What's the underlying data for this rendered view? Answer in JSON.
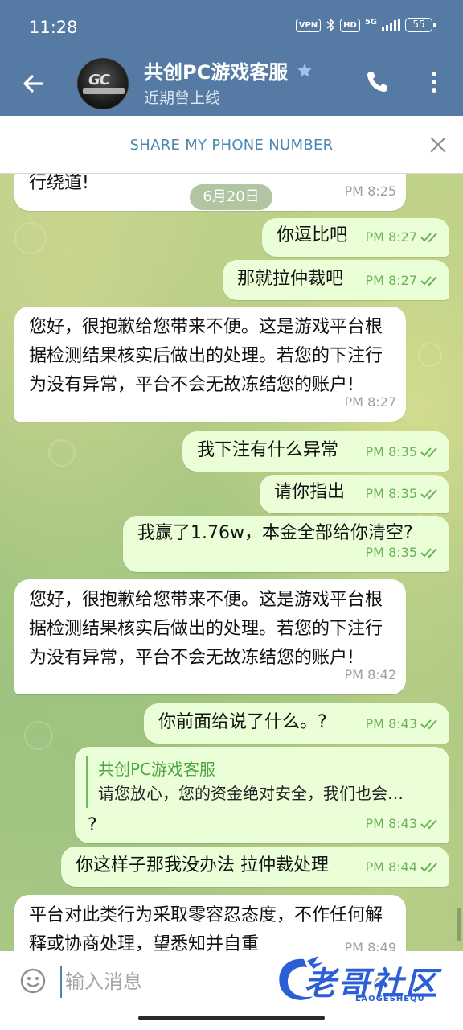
{
  "status_bar": {
    "time": "11:28",
    "vpn": "VPN",
    "hd": "HD",
    "network": "5G",
    "battery": "55"
  },
  "header": {
    "title": "共创PC游戏客服",
    "status": "近期曾上线",
    "avatar_mark": "GC"
  },
  "share_bar": {
    "label": "SHARE MY PHONE NUMBER"
  },
  "date_pill": "6月20日",
  "messages": [
    {
      "dir": "in",
      "text": "行绕道!",
      "time": "PM 8:25"
    },
    {
      "dir": "out",
      "text": "你逗比吧",
      "time": "PM 8:27"
    },
    {
      "dir": "out",
      "text": "那就拉仲裁吧",
      "time": "PM 8:27"
    },
    {
      "dir": "in",
      "text": "您好，很抱歉给您带来不便。这是游戏平台根据检测结果核实后做出的处理。若您的下注行为没有异常，平台不会无故冻结您的账户!",
      "time": "PM 8:27"
    },
    {
      "dir": "out",
      "text": "我下注有什么异常",
      "time": "PM 8:35"
    },
    {
      "dir": "out",
      "text": "请你指出",
      "time": "PM 8:35"
    },
    {
      "dir": "out",
      "text": "我赢了1.76w，本金全部给你清空?",
      "time": "PM 8:35"
    },
    {
      "dir": "in",
      "text": "您好，很抱歉给您带来不便。这是游戏平台根据检测结果核实后做出的处理。若您的下注行为没有异常，平台不会无故冻结您的账户!",
      "time": "PM 8:42"
    },
    {
      "dir": "out",
      "text": "你前面给说了什么。?",
      "time": "PM 8:43"
    },
    {
      "dir": "out",
      "reply_title": "共创PC游戏客服",
      "reply_text": "请您放心，您的资金绝对安全，我们也会…",
      "text": "?",
      "time": "PM 8:43"
    },
    {
      "dir": "out",
      "text": "你这样子那我没办法 拉仲裁处理",
      "time": "PM 8:44"
    },
    {
      "dir": "in",
      "text": "平台对此类行为采取零容忍态度，不作任何解释或协商处理，望悉知并自重",
      "time": "PM 8:49"
    }
  ],
  "input": {
    "placeholder": "输入消息"
  },
  "watermark": {
    "text": "老哥社区",
    "sub": "LAOGESHEQU"
  },
  "colors": {
    "header_bg": "#557ba4",
    "outgoing_bubble": "#eaffd7",
    "incoming_bubble": "#ffffff",
    "check_color": "#6ab158",
    "share_label": "#4a87b3"
  },
  "icons": [
    "back-arrow-icon",
    "star-icon",
    "phone-icon",
    "more-vert-icon",
    "close-icon",
    "double-check-icon",
    "emoji-icon",
    "attach-icon",
    "bluetooth-icon",
    "signal-icon",
    "battery-icon"
  ]
}
